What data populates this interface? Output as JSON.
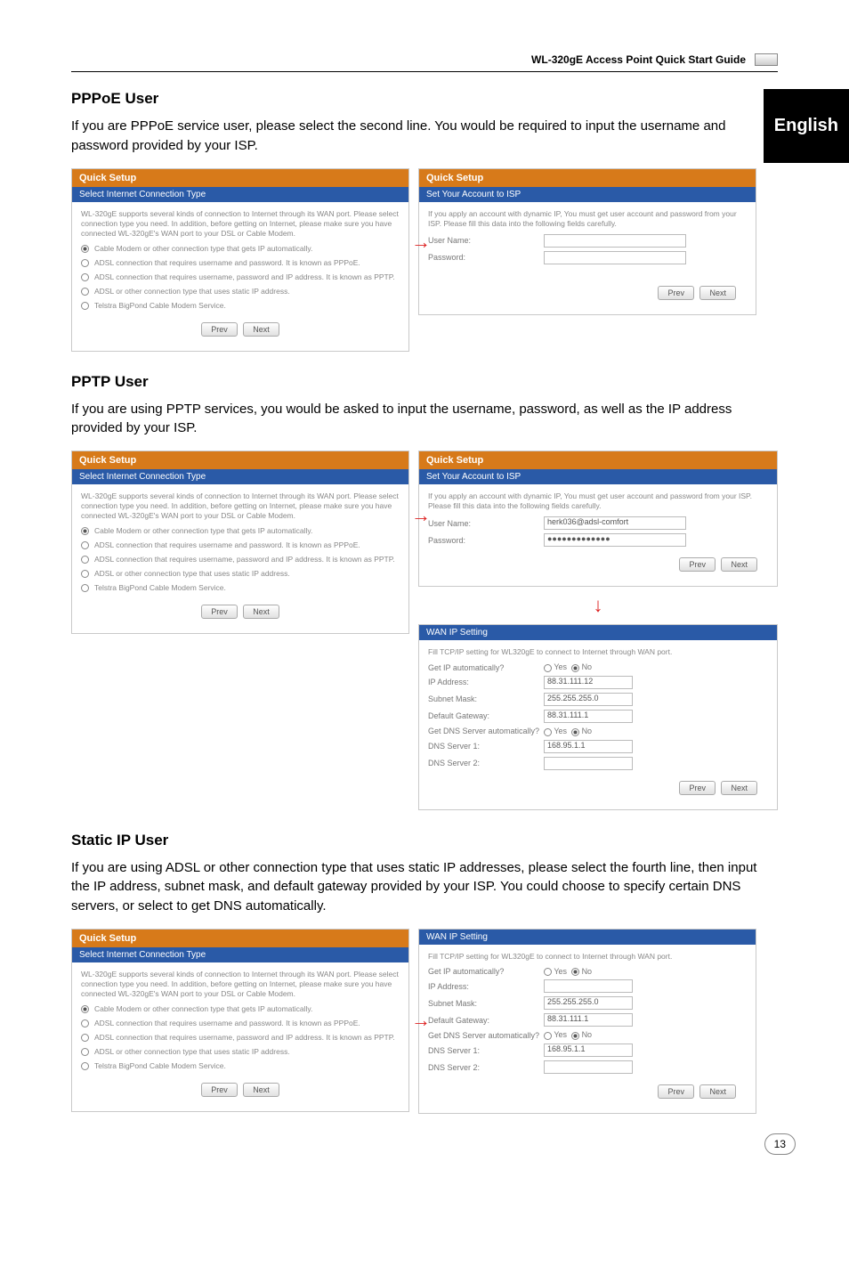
{
  "header": {
    "guide_title": "WL-320gE Access Point Quick Start Guide"
  },
  "side_tab": "English",
  "pppoe": {
    "heading": "PPPoE User",
    "body": "If you are PPPoE service user, please select the second line. You would be required to input the username and password provided by your ISP.",
    "left": {
      "title": "Quick Setup",
      "sub": "Select Internet Connection Type",
      "intro": "WL-320gE supports several kinds of connection to Internet through its WAN port. Please select connection type you need. In addition, before getting on Internet, please make sure you have connected WL-320gE's WAN port to your DSL or Cable Modem.",
      "opts": [
        "Cable Modem or other connection type that gets IP automatically.",
        "ADSL connection that requires username and password. It is known as PPPoE.",
        "ADSL connection that requires username, password and IP address. It is known as PPTP.",
        "ADSL or other connection type that uses static IP address.",
        "Telstra BigPond Cable Modem Service."
      ],
      "prev": "Prev",
      "next": "Next"
    },
    "right": {
      "title": "Quick Setup",
      "sub": "Set Your Account to ISP",
      "intro": "If you apply an account with dynamic IP, You must get user account and password from your ISP. Please fill this data into the following fields carefully.",
      "user_label": "User Name:",
      "pass_label": "Password:",
      "prev": "Prev",
      "next": "Next"
    }
  },
  "pptp": {
    "heading": "PPTP User",
    "body": "If you are using PPTP services, you would be asked to input the username, password, as well as the IP address provided by your ISP.",
    "left": {
      "title": "Quick Setup",
      "sub": "Select Internet Connection Type",
      "intro": "WL-320gE supports several kinds of connection to Internet through its WAN port. Please select connection type you need. In addition, before getting on Internet, please make sure you have connected WL-320gE's WAN port to your DSL or Cable Modem.",
      "opts": [
        "Cable Modem or other connection type that gets IP automatically.",
        "ADSL connection that requires username and password. It is known as PPPoE.",
        "ADSL connection that requires username, password and IP address. It is known as PPTP.",
        "ADSL or other connection type that uses static IP address.",
        "Telstra BigPond Cable Modem Service."
      ],
      "prev": "Prev",
      "next": "Next"
    },
    "right_top": {
      "title": "Quick Setup",
      "sub": "Set Your Account to ISP",
      "intro": "If you apply an account with dynamic IP, You must get user account and password from your ISP. Please fill this data into the following fields carefully.",
      "user_label": "User Name:",
      "user_val": "herk036@adsl-comfort",
      "pass_label": "Password:",
      "pass_val": "●●●●●●●●●●●●●",
      "prev": "Prev",
      "next": "Next"
    },
    "right_bottom": {
      "sub": "WAN IP Setting",
      "intro": "Fill TCP/IP setting for WL320gE to connect to Internet through WAN port.",
      "rows": {
        "getip_label": "Get IP automatically?",
        "getip_val_yes": "Yes",
        "getip_val_no": "No",
        "ipaddr_label": "IP Address:",
        "ipaddr_val": "88.31.111.12",
        "subnet_label": "Subnet Mask:",
        "subnet_val": "255.255.255.0",
        "gateway_label": "Default Gateway:",
        "gateway_val": "88.31.111.1",
        "getdns_label": "Get DNS Server automatically?",
        "dns1_label": "DNS Server 1:",
        "dns1_val": "168.95.1.1",
        "dns2_label": "DNS Server 2:",
        "dns2_val": ""
      },
      "prev": "Prev",
      "next": "Next"
    }
  },
  "static": {
    "heading": "Static IP User",
    "body": "If you are using ADSL or other connection type that uses static IP addresses, please select the fourth line, then input the IP address, subnet mask, and default gateway provided by your ISP. You could choose to specify certain DNS servers, or select to get DNS automatically.",
    "left": {
      "title": "Quick Setup",
      "sub": "Select Internet Connection Type",
      "intro": "WL-320gE supports several kinds of connection to Internet through its WAN port. Please select connection type you need. In addition, before getting on Internet, please make sure you have connected WL-320gE's WAN port to your DSL or Cable Modem.",
      "opts": [
        "Cable Modem or other connection type that gets IP automatically.",
        "ADSL connection that requires username and password. It is known as PPPoE.",
        "ADSL connection that requires username, password and IP address. It is known as PPTP.",
        "ADSL or other connection type that uses static IP address.",
        "Telstra BigPond Cable Modem Service."
      ],
      "prev": "Prev",
      "next": "Next"
    },
    "right": {
      "sub": "WAN IP Setting",
      "intro": "Fill TCP/IP setting for WL320gE to connect to Internet through WAN port.",
      "rows": {
        "getip_label": "Get IP automatically?",
        "ipaddr_label": "IP Address:",
        "subnet_label": "Subnet Mask:",
        "subnet_val": "255.255.255.0",
        "gateway_label": "Default Gateway:",
        "gateway_val": "88.31.111.1",
        "getdns_label": "Get DNS Server automatically?",
        "dns1_label": "DNS Server 1:",
        "dns1_val": "168.95.1.1",
        "dns2_label": "DNS Server 2:"
      },
      "yes": "Yes",
      "no": "No",
      "prev": "Prev",
      "next": "Next"
    }
  },
  "page_number": "13"
}
